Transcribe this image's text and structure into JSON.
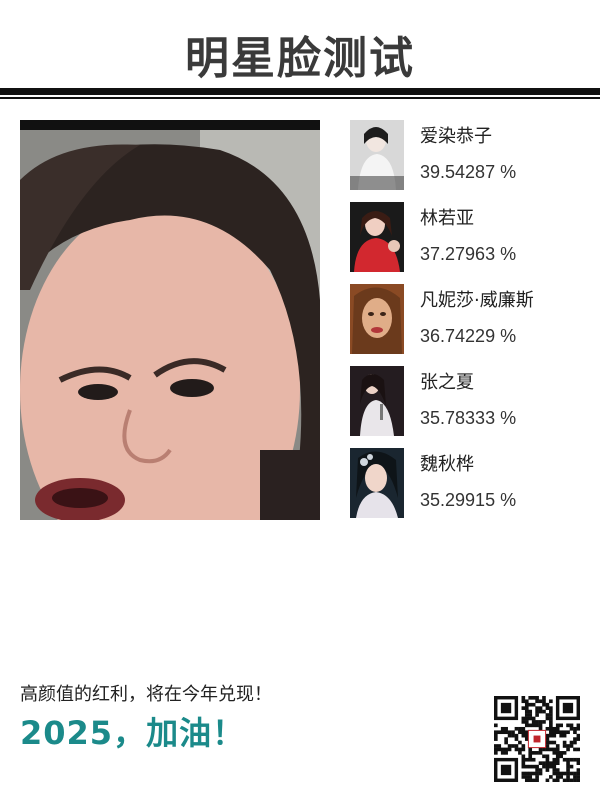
{
  "header": {
    "title": "明星脸测试"
  },
  "results": [
    {
      "name": "爱染恭子",
      "score": "39.54287 %",
      "thumb_color": "#c9c9c9"
    },
    {
      "name": "林若亚",
      "score": "37.27963 %",
      "thumb_color": "#c0252b"
    },
    {
      "name": "凡妮莎·威廉斯",
      "score": "36.74229 %",
      "thumb_color": "#b06a3b"
    },
    {
      "name": "张之夏",
      "score": "35.78333 %",
      "thumb_color": "#2a2226"
    },
    {
      "name": "魏秋桦",
      "score": "35.29915 %",
      "thumb_color": "#1c2a33"
    }
  ],
  "footer": {
    "slogan": "高颜值的红利，将在今年兑现！",
    "motto": "2025，加油！"
  },
  "colors": {
    "accent": "#1b8a8a",
    "rule": "#111111"
  }
}
